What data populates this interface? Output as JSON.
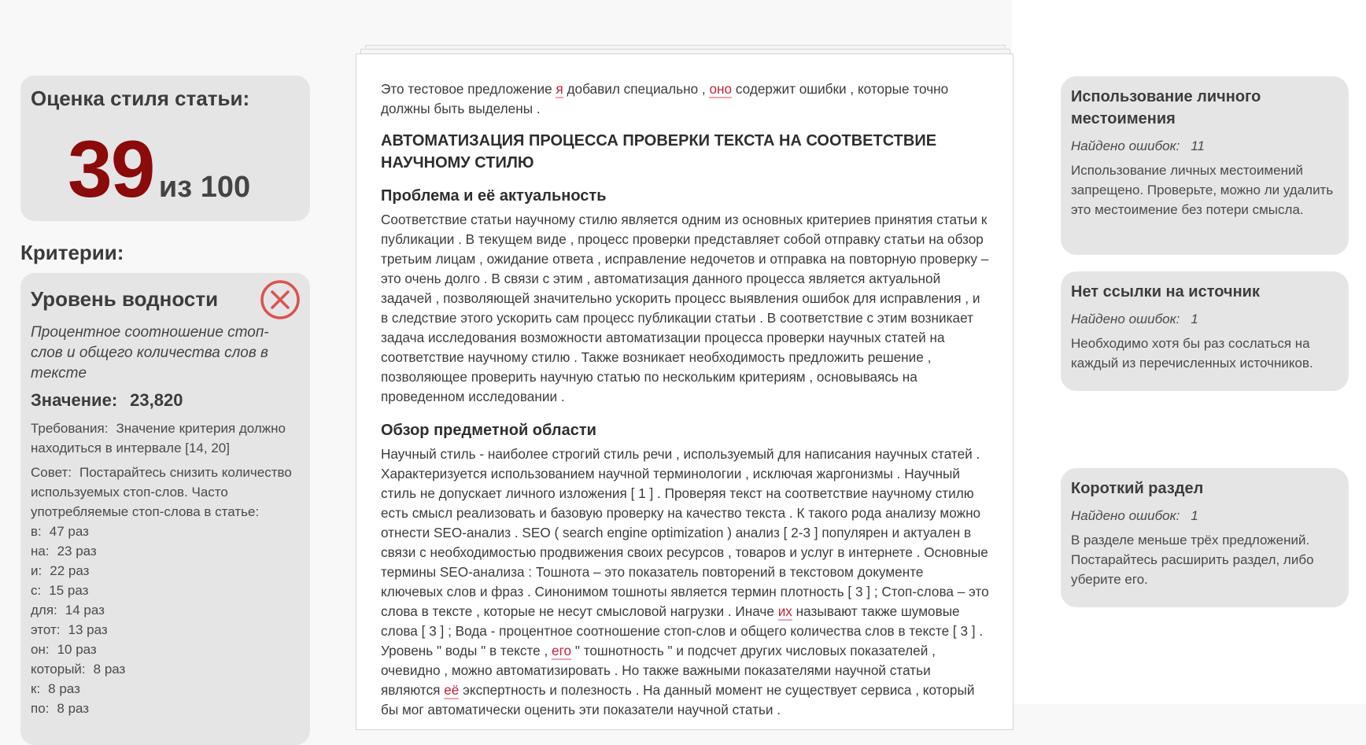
{
  "score": {
    "title": "Оценка стиля статьи:",
    "value": "39",
    "max_label": "из 100"
  },
  "criteria": {
    "heading": "Критерии:",
    "items": [
      {
        "title": "Уровень водности",
        "status_icon": "failed-x-icon",
        "description": "Процентное соотношение стоп-слов и общего количества слов в тексте",
        "value_label": "Значение:",
        "value": "23,820",
        "requirements_label": "Требования:",
        "requirements": "Значение критерия должно находиться в интервале [14, 20]",
        "advice_label": "Совет:",
        "advice": "Постарайтесь снизить количество используемых стоп-слов. Часто употребляемые стоп-слова в статье:",
        "stop_words": [
          {
            "word": "в:",
            "count": "47 раз"
          },
          {
            "word": "на:",
            "count": "23 раз"
          },
          {
            "word": "и:",
            "count": "22 раз"
          },
          {
            "word": "с:",
            "count": "15 раз"
          },
          {
            "word": "для:",
            "count": "14 раз"
          },
          {
            "word": "этот:",
            "count": "13 раз"
          },
          {
            "word": "он:",
            "count": "10 раз"
          },
          {
            "word": "который:",
            "count": "8 раз"
          },
          {
            "word": "к:",
            "count": "8 раз"
          },
          {
            "word": "по:",
            "count": "8 раз"
          }
        ]
      }
    ]
  },
  "document": {
    "intro": {
      "a": "Это тестовое предложение ",
      "e1": "я",
      "b": " добавил специально , ",
      "e2": "оно",
      "c": " содержит ошибки , которые точно должны быть выделены ."
    },
    "title": "АВТОМАТИЗАЦИЯ ПРОЦЕССА ПРОВЕРКИ ТЕКСТА НА СООТВЕТСТВИЕ НАУЧНОМУ СТИЛЮ",
    "section1": {
      "heading": "Проблема и её актуальность",
      "text": "Соответствие статьи научному стилю является одним из основных критериев принятия статьи к публикации . В текущем виде , процесс проверки представляет собой отправку статьи на обзор третьим лицам , ожидание ответа , исправление недочетов и отправка на повторную проверку – это очень долго . В связи с этим , автоматизация данного процесса является актуальной задачей , позволяющей значительно ускорить процесс выявления ошибок для исправления , и в следствие этого ускорить сам процесс публикации статьи . В соответствие с этим возникает задача исследования возможности автоматизации процесса проверки научных статей на соответствие научному стилю . Также возникает необходимость предложить решение , позволяющее проверить научную статью по нескольким критериям , основываясь на проведенном исследовании ."
    },
    "section2": {
      "heading": "Обзор предметной области",
      "a": "Научный стиль - наиболее строгий стиль речи , используемый для написания научных статей . Характеризуется использованием научной терминологии , исключая жаргонизмы . Научный стиль не допускает личного изложения [ 1 ] . Проверяя текст на соответствие научному стилю есть смысл реализовать и базовую проверку на качество текста . К такого рода анализу можно отнести SEO-анализ . SEO ( search engine optimization ) анализ [ 2-3 ] популярен и актуален в связи с необходимостью продвижения своих ресурсов , товаров и услуг в интернете . Основные термины SEO-анализа : Тошнота – это показатель повторений в текстовом документе ключевых слов и фраз . Синонимом тошноты является термин плотность [ 3 ] ; Стоп-слова – это слова в тексте , которые не несут смысловой нагрузки . Иначе ",
      "e1": "их",
      "b": " называют также шумовые слова [ 3 ] ; Вода - процентное соотношение стоп-слов и общего количества слов в тексте [ 3 ] . Уровень \" воды \" в тексте , ",
      "e2": "его",
      "c": " \" тошнотность \" и подсчет других числовых показателей , очевидно , можно автоматизировать . Но также важными показателями научной статьи являются ",
      "e3": "её",
      "d": " экспертность и полезность . На данный момент не существует сервиса , который бы мог автоматически оценить эти показатели научной статьи ."
    }
  },
  "errors": [
    {
      "title": "Использование личного местоимения",
      "count_label": "Найдено ошибок:",
      "count": "11",
      "message": "Использование личных местоимений запрещено. Проверьте, можно ли удалить это местоимение без потери смысла."
    },
    {
      "title": "Нет ссылки на источник",
      "count_label": "Найдено ошибок:",
      "count": "1",
      "message": "Необходимо хотя бы раз сослаться на каждый из перечисленных источников."
    },
    {
      "title": "Короткий раздел",
      "count_label": "Найдено ошибок:",
      "count": "1",
      "message": "В разделе меньше трёх предложений. Постарайтесь расширить раздел, либо уберите его."
    }
  ],
  "colors": {
    "score": "#8b0a0a",
    "fail_icon": "#d9534f",
    "error_highlight": "#c0243a",
    "card_bg": "#e5e5e5"
  }
}
